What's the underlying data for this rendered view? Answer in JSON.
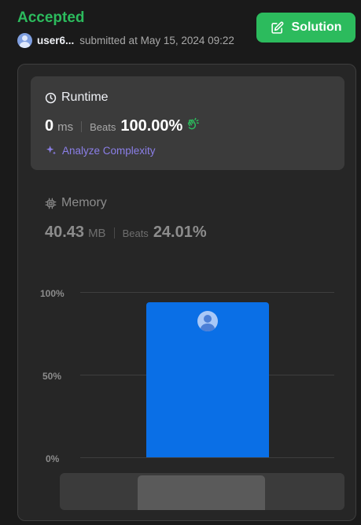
{
  "header": {
    "status": "Accepted",
    "username": "user6...",
    "submitted_text": "submitted at May 15, 2024 09:22",
    "solution_label": "Solution"
  },
  "runtime": {
    "title": "Runtime",
    "value": "0",
    "unit": "ms",
    "beats_label": "Beats",
    "beats_value": "100.00%",
    "analyze_label": "Analyze Complexity"
  },
  "memory": {
    "title": "Memory",
    "value": "40.43",
    "unit": "MB",
    "beats_label": "Beats",
    "beats_value": "24.01%"
  },
  "chart_data": {
    "type": "bar",
    "y_ticks": [
      "100%",
      "50%",
      "0%"
    ],
    "ylim": [
      0,
      100
    ],
    "values": [
      94
    ],
    "grid": true
  },
  "colors": {
    "accent_green": "#2cbb5d",
    "bar_blue": "#0a6fe6",
    "analyze_purple": "#8b7fe8"
  },
  "icons": {
    "edit": "edit-icon",
    "clock": "clock-icon",
    "sparkle": "sparkle-icon",
    "chip": "chip-icon",
    "clap": "clap-icon"
  }
}
